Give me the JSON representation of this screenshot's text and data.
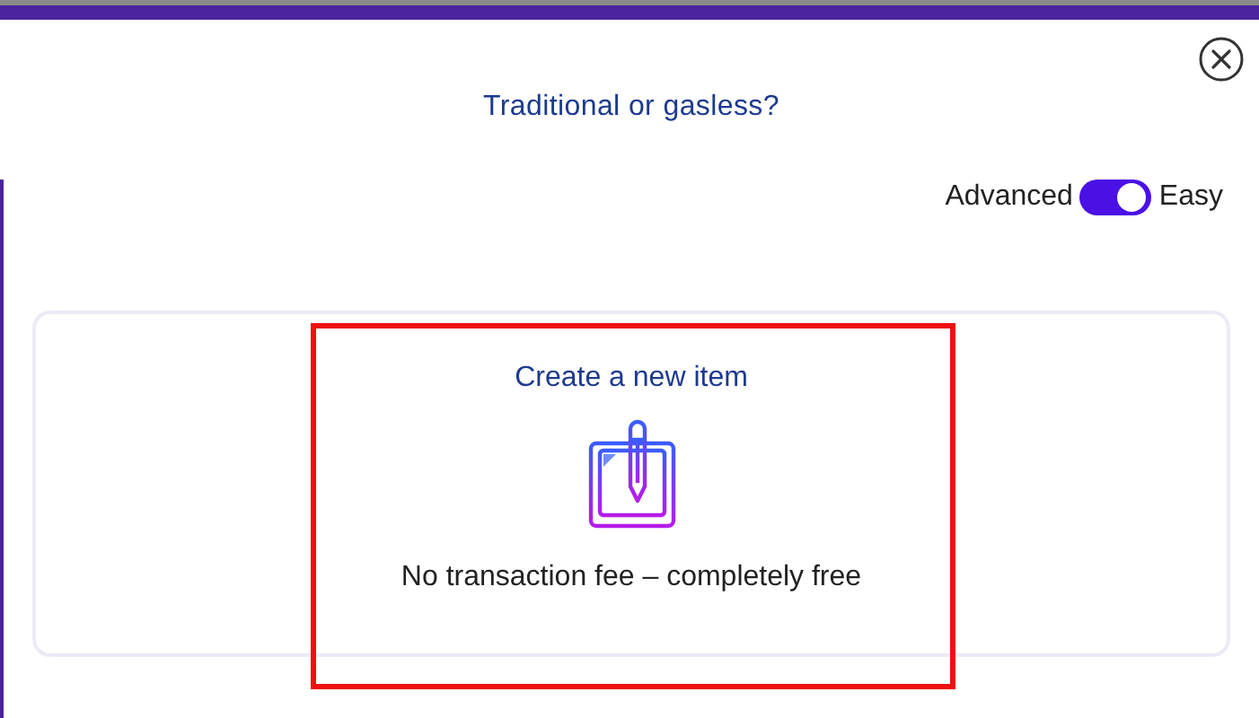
{
  "dialog": {
    "title": "Traditional or gasless?"
  },
  "mode_toggle": {
    "left_label": "Advanced",
    "right_label": "Easy",
    "on": true
  },
  "option_card": {
    "title": "Create a new item",
    "description": "No transaction fee – completely free"
  }
}
